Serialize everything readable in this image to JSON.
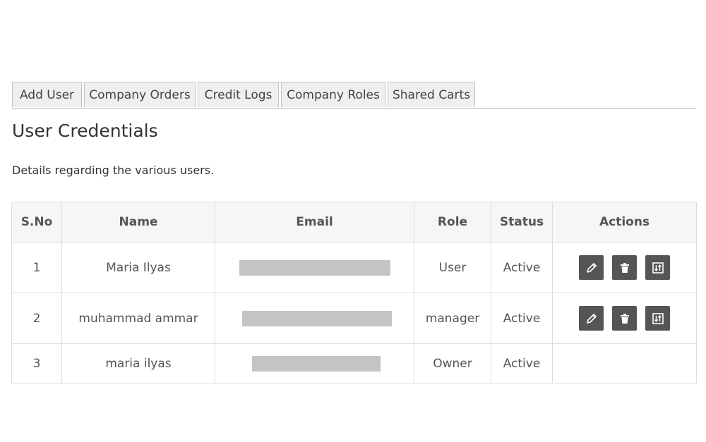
{
  "tabs": [
    {
      "label": "Add User"
    },
    {
      "label": "Company Orders"
    },
    {
      "label": "Credit Logs"
    },
    {
      "label": "Company Roles"
    },
    {
      "label": "Shared Carts"
    }
  ],
  "page": {
    "title": "User Credentials",
    "description": "Details regarding the various users."
  },
  "table": {
    "headers": {
      "sno": "S.No",
      "name": "Name",
      "email": "Email",
      "role": "Role",
      "status": "Status",
      "actions": "Actions"
    },
    "rows": [
      {
        "sno": "1",
        "name": "Maria Ilyas",
        "role": "User",
        "status": "Active",
        "actions": [
          "pencil-icon",
          "trash-icon",
          "sort-icon"
        ]
      },
      {
        "sno": "2",
        "name": "muhammad ammar",
        "role": "manager",
        "status": "Active",
        "actions": [
          "pencil-icon",
          "trash-icon",
          "sort-icon"
        ]
      },
      {
        "sno": "3",
        "name": "maria ilyas",
        "role": "Owner",
        "status": "Active",
        "actions": []
      }
    ]
  },
  "colors": {
    "action_button": "#555555",
    "redaction": "#c4c4c4",
    "tab_background": "#efefef"
  }
}
